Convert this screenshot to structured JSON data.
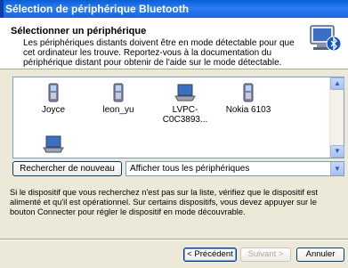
{
  "window": {
    "title": "Sélection de périphérique Bluetooth"
  },
  "header": {
    "title": "Sélectionner un périphérique",
    "description": "Les périphériques distants doivent être en mode détectable pour que cet ordinateur les trouve. Reportez-vous à la documentation du périphérique distant pour obtenir de l'aide sur le mode détectable."
  },
  "devices": [
    {
      "label": "Joyce",
      "icon": "mobile-phone-icon"
    },
    {
      "label": "leon_yu",
      "icon": "mobile-phone-icon"
    },
    {
      "label": "LVPC-C0C3893...",
      "icon": "laptop-icon"
    },
    {
      "label": "Nokia 6103",
      "icon": "mobile-phone-icon"
    },
    {
      "label": "",
      "icon": "laptop-icon"
    }
  ],
  "controls": {
    "search_button": "Rechercher de nouveau",
    "filter_selected": "Afficher tous les périphériques"
  },
  "info_text": "Si le dispositif que vous recherchez n'est pas sur la liste, vérifiez que le dispositif est alimenté et qu'il est opérationnel. Sur certains dispositifs, vous devez appuyer sur le bouton Connecter pour régler le dispositif en mode découvrable.",
  "buttons": {
    "back": "< Précédent",
    "next": "Suivant >",
    "cancel": "Annuler"
  },
  "colors": {
    "titlebar": "#1c63dc",
    "dialog_bg": "#ece9d8"
  }
}
